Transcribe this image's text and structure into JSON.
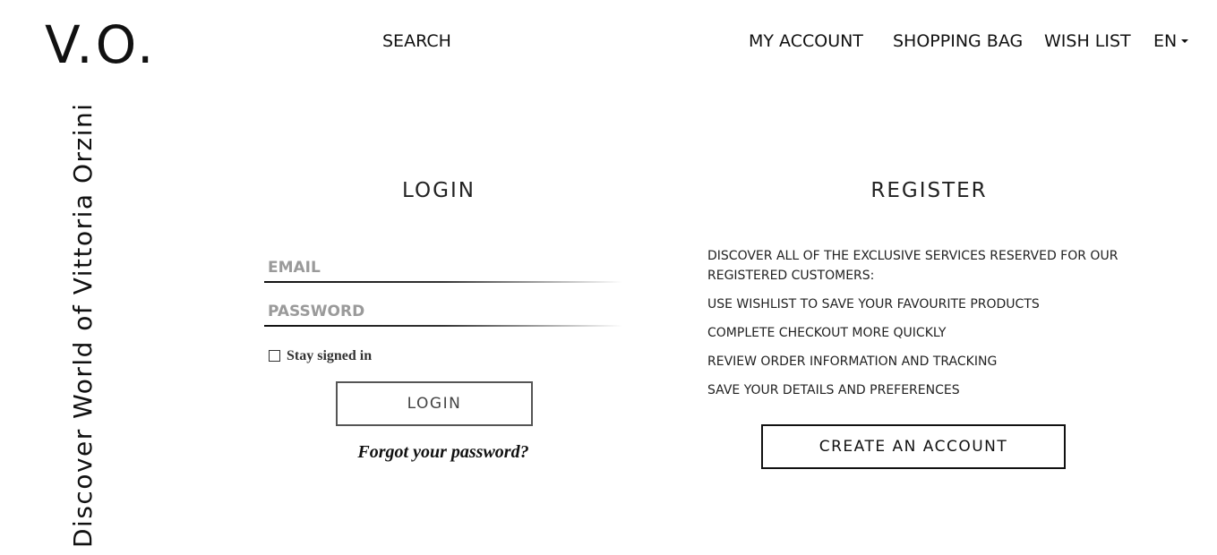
{
  "header": {
    "logo": "V.O.",
    "search_label": "SEARCH",
    "my_account_label": "MY ACCOUNT",
    "shopping_bag_label": "SHOPPING BAG",
    "wish_list_label": "WISH LIST",
    "language_label": "EN"
  },
  "tagline": "Discover World of Vittoria Orzini",
  "login": {
    "title": "LOGIN",
    "email_placeholder": "EMAIL",
    "password_placeholder": "PASSWORD",
    "stay_signed_in_label": "Stay signed in",
    "login_button_label": "LOGIN",
    "forgot_password_label": "Forgot your password?"
  },
  "register": {
    "title": "REGISTER",
    "intro": "DISCOVER ALL OF THE EXCLUSIVE SERVICES RESERVED FOR OUR REGISTERED CUSTOMERS:",
    "benefits": [
      "USE WISHLIST TO SAVE YOUR FAVOURITE PRODUCTS",
      "COMPLETE CHECKOUT MORE QUICKLY",
      "REVIEW ORDER INFORMATION AND TRACKING",
      "SAVE YOUR DETAILS AND PREFERENCES"
    ],
    "create_account_label": "CREATE AN ACCOUNT"
  }
}
